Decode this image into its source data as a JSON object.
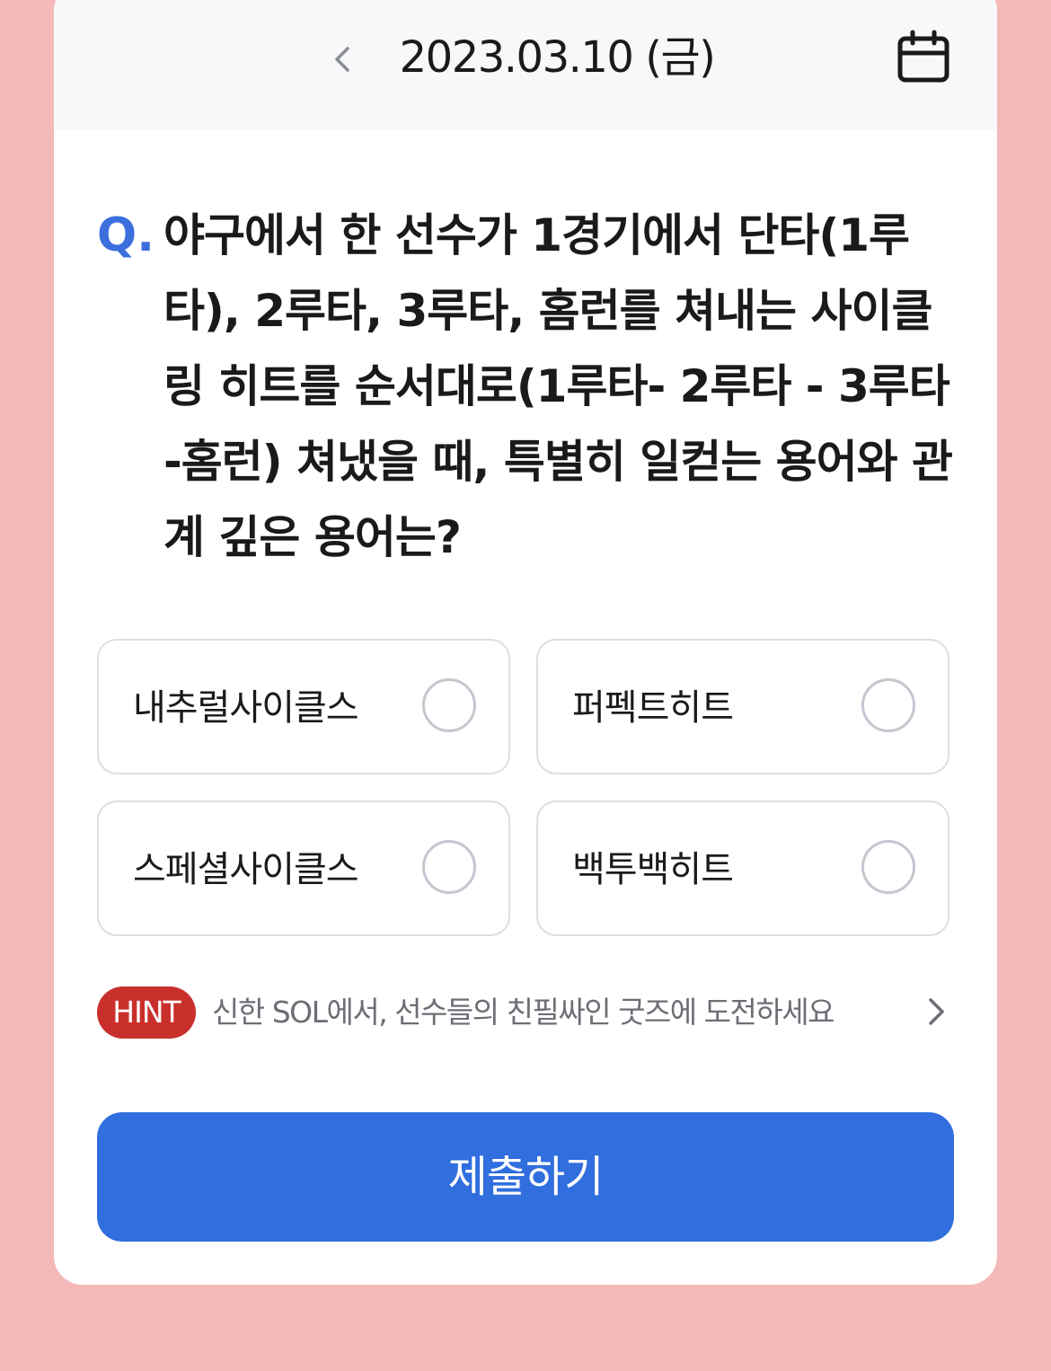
{
  "header": {
    "date": "2023.03.10 (금)",
    "prev_icon": "chevron-left-icon",
    "calendar_icon": "calendar-icon"
  },
  "question": {
    "marker": "Q.",
    "text": "야구에서 한 선수가 1경기에서 단타(1루타), 2루타, 3루타, 홈런를 쳐내는 사이클링 히트를 순서대로(1루타- 2루타 - 3루타 -홈런) 쳐냈을 때, 특별히 일컫는 용어와 관계 깊은 용어는?"
  },
  "options": [
    {
      "label": "내추럴사이클스",
      "selected": false
    },
    {
      "label": "퍼펙트히트",
      "selected": false
    },
    {
      "label": "스페셜사이클스",
      "selected": false
    },
    {
      "label": "백투백히트",
      "selected": false
    }
  ],
  "hint": {
    "badge": "HINT",
    "text": "신한 SOL에서, 선수들의 친필싸인 굿즈에 도전하세요",
    "arrow_icon": "chevron-right-icon"
  },
  "submit": {
    "label": "제출하기"
  },
  "colors": {
    "background": "#f5b9b9",
    "accent": "#316ede",
    "question_marker": "#3a6fdc",
    "hint_badge": "#c9302c"
  }
}
